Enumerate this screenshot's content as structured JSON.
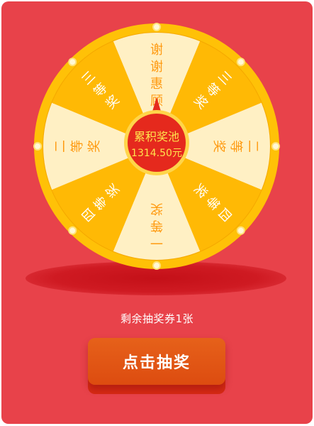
{
  "wheel": {
    "segments": [
      {
        "label": "谢谢惠顾",
        "type": "light"
      },
      {
        "label": "三等奖",
        "type": "dark"
      },
      {
        "label": "二等奖",
        "type": "light"
      },
      {
        "label": "四等奖",
        "type": "dark"
      },
      {
        "label": "一等奖",
        "type": "light"
      },
      {
        "label": "四等奖",
        "type": "dark"
      },
      {
        "label": "二等奖",
        "type": "light"
      },
      {
        "label": "三等奖",
        "type": "dark"
      }
    ],
    "pool_title": "累积奖池",
    "pool_amount": "1314.50元"
  },
  "colors": {
    "background": "#e8424a",
    "rim": "#ffc107",
    "segment_light": "#fff0c4",
    "segment_dark": "#ffb905",
    "segment_text": "#ff9a10",
    "center": "#e5291d",
    "pool_text": "#ffe34d",
    "button": "#dd4c10"
  },
  "remaining_text": "剩余抽奖券1张",
  "draw_button": "点击抽奖"
}
